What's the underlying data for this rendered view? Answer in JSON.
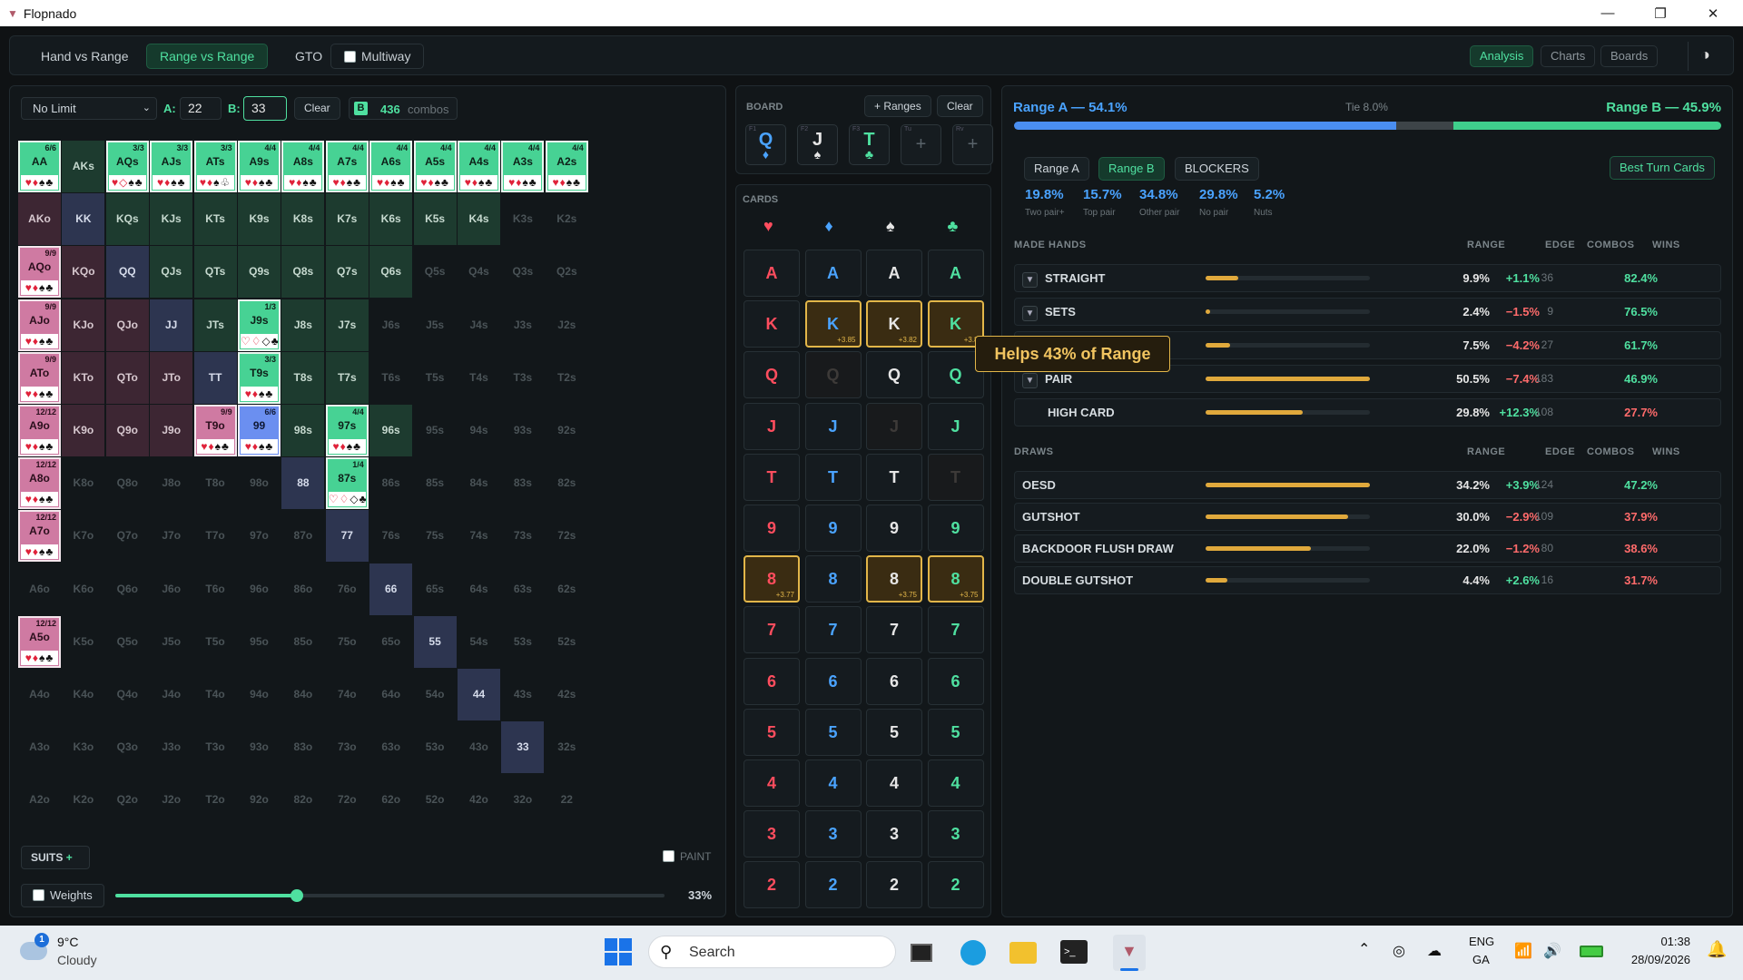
{
  "window": {
    "title": "Flopnado",
    "min": "—",
    "max": "❐",
    "close": "✕"
  },
  "toolbar": {
    "tabs": [
      "Hand vs Range",
      "Range vs Range",
      "GTO"
    ],
    "multiway": "Multiway",
    "right_tabs": [
      "Analysis",
      "Charts",
      "Boards"
    ],
    "theme_icon": "◑"
  },
  "left": {
    "game": "No Limit",
    "a_label": "A:",
    "a_value": "22",
    "b_label": "B:",
    "b_value": "33",
    "clear": "Clear",
    "b_badge": "B",
    "combos_num": "436",
    "combos_label": "combos",
    "suits": "SUITS",
    "suits_plus": "+",
    "paint": "PAINT",
    "weights": "Weights",
    "weight_pct": "33%",
    "weight_value": 0.33
  },
  "grid": {
    "ranks": [
      "A",
      "K",
      "Q",
      "J",
      "T",
      "9",
      "8",
      "7",
      "6",
      "5",
      "4",
      "3",
      "2"
    ],
    "special": {
      "AA": {
        "frac": "6/6",
        "suits": "♥♦♠♣"
      },
      "AQs": {
        "frac": "3/3",
        "suits": "♥◇♠♣"
      },
      "AJs": {
        "frac": "3/3",
        "suits": "♥♦♠♣"
      },
      "ATs": {
        "frac": "3/3",
        "suits": "♥♦♠♧"
      },
      "A9s": {
        "frac": "4/4",
        "suits": "♥♦♠♣"
      },
      "A8s": {
        "frac": "4/4",
        "suits": "♥♦♠♣"
      },
      "A7s": {
        "frac": "4/4",
        "suits": "♥♦♠♣"
      },
      "A6s": {
        "frac": "4/4",
        "suits": "♥♦♠♣"
      },
      "A5s": {
        "frac": "4/4",
        "suits": "♥♦♠♣"
      },
      "A4s": {
        "frac": "4/4",
        "suits": "♥♦♠♣"
      },
      "A3s": {
        "frac": "4/4",
        "suits": "♥♦♠♣"
      },
      "A2s": {
        "frac": "4/4",
        "suits": "♥♦♠♣"
      },
      "AQo": {
        "frac": "9/9",
        "suits": "♥♦♠♣"
      },
      "AJo": {
        "frac": "9/9",
        "suits": "♥♦♠♣"
      },
      "ATo": {
        "frac": "9/9",
        "suits": "♥♦♠♣"
      },
      "A9o": {
        "frac": "12/12",
        "suits": "♥♦♠♣"
      },
      "A8o": {
        "frac": "12/12",
        "suits": "♥♦♠♣"
      },
      "A7o": {
        "frac": "12/12",
        "suits": "♥♦♠♣"
      },
      "A5o": {
        "frac": "12/12",
        "suits": "♥♦♠♣"
      },
      "J9s": {
        "frac": "1/3",
        "suits": "♡♢◇♣"
      },
      "T9s": {
        "frac": "3/3",
        "suits": "♥♦♠♣"
      },
      "T9o": {
        "frac": "9/9",
        "suits": "♥♦♠♣"
      },
      "99": {
        "frac": "6/6",
        "suits": "♥♦♠♣"
      },
      "97s": {
        "frac": "4/4",
        "suits": "♥♦♠♣"
      },
      "87s": {
        "frac": "1/4",
        "suits": "♡♢◇♣"
      }
    }
  },
  "board": {
    "label": "BOARD",
    "ranges_btn": "+ Ranges",
    "clear": "Clear",
    "cards": [
      {
        "n": "F1",
        "rank": "Q",
        "suit": "♦",
        "color": "#4aa3ff"
      },
      {
        "n": "F2",
        "rank": "J",
        "suit": "♠",
        "color": "#e6e6e6"
      },
      {
        "n": "F3",
        "rank": "T",
        "suit": "♣",
        "color": "#4fe0a0"
      },
      {
        "n": "Tu",
        "rank": "+",
        "suit": "",
        "color": "#59636a"
      },
      {
        "n": "Rv",
        "rank": "+",
        "suit": "",
        "color": "#59636a"
      }
    ]
  },
  "cards": {
    "label": "CARDS",
    "suits": [
      {
        "sym": "♥",
        "color": "#ff4d5e"
      },
      {
        "sym": "♦",
        "color": "#4aa3ff"
      },
      {
        "sym": "♠",
        "color": "#e6e6e6"
      },
      {
        "sym": "♣",
        "color": "#4fe0a0"
      }
    ],
    "ranks": [
      "A",
      "K",
      "Q",
      "J",
      "T",
      "9",
      "8",
      "7",
      "6",
      "5",
      "4",
      "3",
      "2"
    ],
    "highlight": {
      "K1": "+3.85",
      "K2": "+3.82",
      "K3": "+3.8",
      "80": "+3.77",
      "82": "+3.75",
      "83": "+3.75"
    },
    "dim": [
      "Q1",
      "J2",
      "T3"
    ],
    "tooltip": "Helps 43% of Range"
  },
  "analysis": {
    "range_a": "Range A — 54.1%",
    "tie": "Tie 8.0%",
    "range_b": "Range B — 45.9%",
    "equity": {
      "a": 54.1,
      "tie": 8.0,
      "b": 45.9
    },
    "tabs": [
      "Range A",
      "Range B",
      "BLOCKERS"
    ],
    "best_turn": "Best Turn Cards",
    "stats": [
      {
        "v": "19.8%",
        "l": "Two pair+"
      },
      {
        "v": "15.7%",
        "l": "Top pair"
      },
      {
        "v": "34.8%",
        "l": "Other pair"
      },
      {
        "v": "29.8%",
        "l": "No pair"
      },
      {
        "v": "5.2%",
        "l": "Nuts"
      }
    ],
    "headers": {
      "made": "MADE HANDS",
      "draws": "DRAWS",
      "range": "RANGE",
      "edge": "EDGE",
      "combos": "COMBOS",
      "wins": "WINS"
    },
    "made": [
      {
        "name": "STRAIGHT",
        "caret": true,
        "bar": 0.2,
        "range": "9.9%",
        "edge": "+1.1%",
        "combos": "36",
        "wins": "82.4%"
      },
      {
        "name": "SETS",
        "caret": true,
        "bar": 0.03,
        "range": "2.4%",
        "edge": "−1.5%",
        "combos": "9",
        "wins": "76.5%"
      },
      {
        "name": "",
        "caret": false,
        "bar": 0.15,
        "range": "7.5%",
        "edge": "−4.2%",
        "combos": "27",
        "wins": "61.7%"
      },
      {
        "name": "PAIR",
        "caret": true,
        "bar": 1.0,
        "range": "50.5%",
        "edge": "−7.4%",
        "combos": "183",
        "wins": "46.9%"
      },
      {
        "name": "HIGH CARD",
        "caret": false,
        "bar": 0.59,
        "range": "29.8%",
        "edge": "+12.3%",
        "combos": "108",
        "wins": "27.7%"
      }
    ],
    "draws": [
      {
        "name": "OESD",
        "bar": 1.0,
        "range": "34.2%",
        "edge": "+3.9%",
        "combos": "124",
        "wins": "47.2%"
      },
      {
        "name": "GUTSHOT",
        "bar": 0.87,
        "range": "30.0%",
        "edge": "−2.9%",
        "combos": "109",
        "wins": "37.9%"
      },
      {
        "name": "BACKDOOR FLUSH DRAW",
        "bar": 0.64,
        "range": "22.0%",
        "edge": "−1.2%",
        "combos": "80",
        "wins": "38.6%"
      },
      {
        "name": "DOUBLE GUTSHOT",
        "bar": 0.13,
        "range": "4.4%",
        "edge": "+2.6%",
        "combos": "16",
        "wins": "31.7%"
      }
    ]
  },
  "taskbar": {
    "temp": "9°C",
    "weather": "Cloudy",
    "badge": "1",
    "search": "Search",
    "lang1": "ENG",
    "lang2": "GA",
    "time": "01:38",
    "date": "28/09/2026"
  }
}
